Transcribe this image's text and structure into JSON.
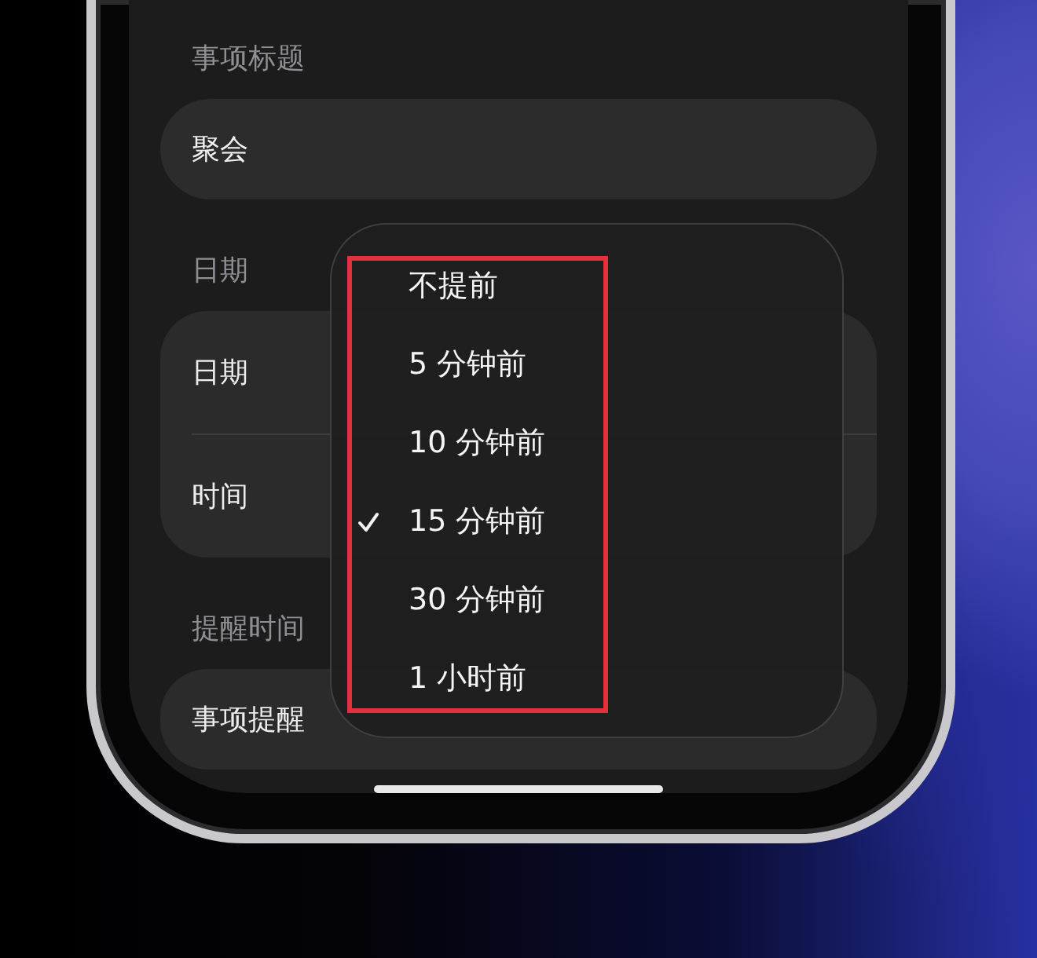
{
  "form": {
    "sections": [
      {
        "header": "事项标题",
        "kind": "field",
        "value": "聚会"
      },
      {
        "header": "日期",
        "kind": "list",
        "rows": [
          {
            "label": "日期"
          },
          {
            "label": "时间"
          }
        ]
      },
      {
        "header": "提醒时间",
        "kind": "list",
        "rows": [
          {
            "label": "事项提醒"
          }
        ]
      }
    ]
  },
  "menu": {
    "highlighted": true,
    "items": [
      {
        "label": "不提前",
        "selected": false
      },
      {
        "label": "5 分钟前",
        "selected": false
      },
      {
        "label": "10 分钟前",
        "selected": false
      },
      {
        "label": "15 分钟前",
        "selected": true
      },
      {
        "label": "30 分钟前",
        "selected": false
      },
      {
        "label": "1 小时前",
        "selected": false
      }
    ]
  }
}
